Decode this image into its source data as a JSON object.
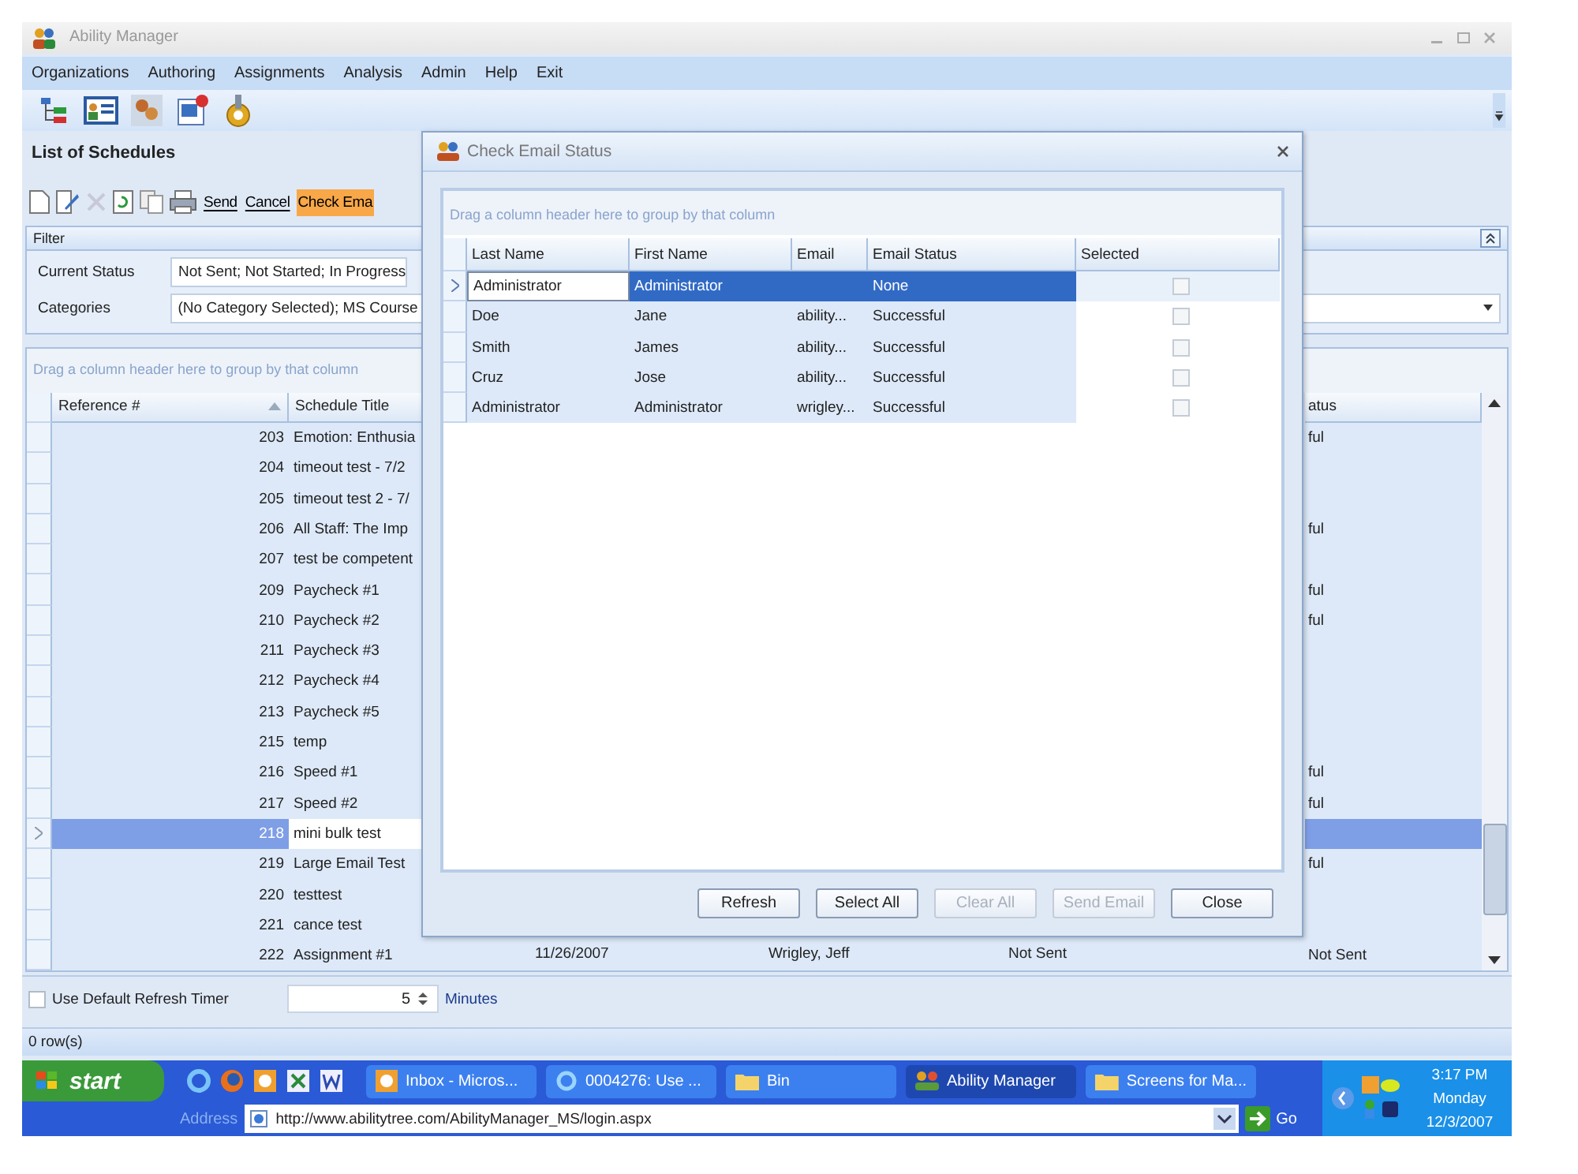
{
  "window": {
    "title": "Ability Manager"
  },
  "menu": [
    "Organizations",
    "Authoring",
    "Assignments",
    "Analysis",
    "Admin",
    "Help",
    "Exit"
  ],
  "page_title": "List of Schedules",
  "actions": [
    {
      "label": "Send",
      "highlighted": false
    },
    {
      "label": "Cancel",
      "highlighted": false
    },
    {
      "label": "Check Ema",
      "highlighted": true
    }
  ],
  "filter": {
    "title": "Filter",
    "fields": [
      {
        "label": "Current Status",
        "value": "Not Sent; Not Started; In Progress"
      },
      {
        "label": "Categories",
        "value": "(No Category Selected); MS Course"
      }
    ]
  },
  "schedules": {
    "group_hint": "Drag a column header here to group by that column",
    "columns": [
      "Reference #",
      "Schedule Title",
      "atus"
    ],
    "rows": [
      {
        "ref": "203",
        "title": "Emotion: Enthusia",
        "status": "ful",
        "selected": false
      },
      {
        "ref": "204",
        "title": "timeout test - 7/2",
        "selected": false
      },
      {
        "ref": "205",
        "title": "timeout test 2 - 7/",
        "selected": false
      },
      {
        "ref": "206",
        "title": "All Staff: The Imp",
        "status": "ful",
        "selected": false
      },
      {
        "ref": "207",
        "title": "test be competent",
        "selected": false
      },
      {
        "ref": "209",
        "title": "Paycheck #1",
        "status": "ful",
        "selected": false
      },
      {
        "ref": "210",
        "title": "Paycheck #2",
        "status": "ful",
        "selected": false
      },
      {
        "ref": "211",
        "title": "Paycheck #3",
        "selected": false
      },
      {
        "ref": "212",
        "title": "Paycheck #4",
        "selected": false
      },
      {
        "ref": "213",
        "title": "Paycheck #5",
        "selected": false
      },
      {
        "ref": "215",
        "title": "temp",
        "selected": false
      },
      {
        "ref": "216",
        "title": "Speed #1",
        "status": "ful",
        "selected": false
      },
      {
        "ref": "217",
        "title": "Speed #2",
        "status": "ful",
        "selected": false
      },
      {
        "ref": "218",
        "title": "mini bulk test",
        "selected": true
      },
      {
        "ref": "219",
        "title": "Large Email Test",
        "status": "ful",
        "selected": false
      },
      {
        "ref": "220",
        "title": "testtest",
        "selected": false
      },
      {
        "ref": "221",
        "title": "cance test",
        "selected": false
      },
      {
        "ref": "222",
        "title": "Assignment #1",
        "date": "11/26/2007",
        "owner": "Wrigley, Jeff",
        "state": "Not Sent",
        "status": "Not Sent",
        "selected": false
      }
    ]
  },
  "refresh_timer": {
    "label": "Use Default Refresh Timer",
    "checked": false,
    "value": "5",
    "unit": "Minutes"
  },
  "status_bar": "0 row(s)",
  "dialog": {
    "title": "Check Email Status",
    "group_hint": "Drag a column header here to group by that column",
    "columns": [
      "Last Name",
      "First Name",
      "Email",
      "Email Status",
      "Selected"
    ],
    "rows": [
      {
        "last": "Administrator",
        "first": "Administrator",
        "status": "None",
        "checked": false,
        "selected": true
      },
      {
        "last": "Doe",
        "first": "Jane",
        "email": "ability...",
        "status": "Successful",
        "checked": false,
        "selected": false
      },
      {
        "last": "Smith",
        "first": "James",
        "email": "ability...",
        "status": "Successful",
        "checked": false,
        "selected": false
      },
      {
        "last": "Cruz",
        "first": "Jose",
        "email": "ability...",
        "status": "Successful",
        "checked": false,
        "selected": false
      },
      {
        "last": "Administrator",
        "first": "Administrator",
        "email": "wrigley...",
        "status": "Successful",
        "checked": false,
        "selected": false
      }
    ],
    "buttons": [
      {
        "label": "Refresh",
        "disabled": false
      },
      {
        "label": "Select All",
        "disabled": false
      },
      {
        "label": "Clear All",
        "disabled": true
      },
      {
        "label": "Send Email",
        "disabled": true
      },
      {
        "label": "Close",
        "disabled": false
      }
    ]
  },
  "taskbar": {
    "start": "start",
    "tasks": [
      {
        "label": "Inbox - Micros...",
        "kind": "mail",
        "selected": false
      },
      {
        "label": "0004276: Use ...",
        "kind": "browser",
        "selected": false
      },
      {
        "label": "Bin",
        "kind": "folder",
        "selected": false
      },
      {
        "label": "Ability Manager",
        "kind": "app",
        "selected": true
      },
      {
        "label": "Screens for Ma...",
        "kind": "folder",
        "selected": false
      }
    ],
    "address_label": "Address",
    "url": "http://www.abilitytree.com/AbilityManager_MS/login.aspx",
    "go": "Go",
    "clock": [
      "3:17 PM",
      "Monday",
      "12/3/2007"
    ]
  }
}
